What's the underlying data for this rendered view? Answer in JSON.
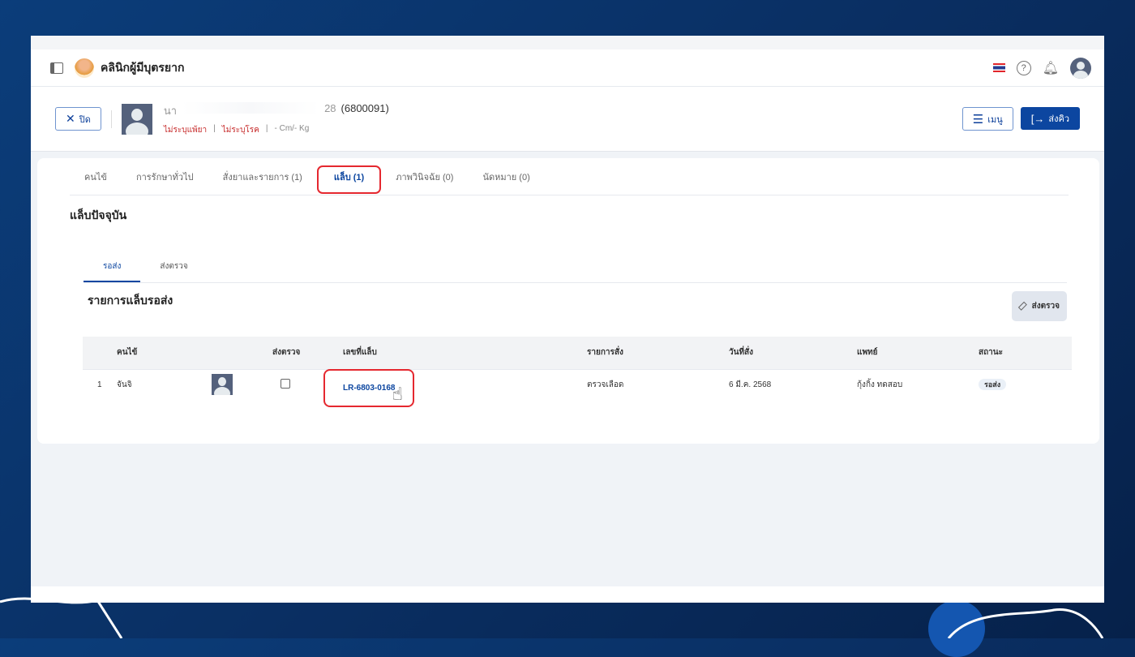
{
  "app": {
    "title": "คลินิกผู้มีบุตรยาก"
  },
  "patient": {
    "close_label": "ปิด",
    "name_prefix": "นา",
    "name_suffix": "28",
    "hn": "(6800091)",
    "allergy": "ไม่ระบุแพ้ยา",
    "disease": "ไม่ระบุโรค",
    "body": "- Cm/- Kg",
    "menu_label": "เมนู",
    "queue_label": "ส่งคิว"
  },
  "tabs": [
    {
      "label": "คนไข้"
    },
    {
      "label": "การรักษาทั่วไป"
    },
    {
      "label": "สั่งยาและรายการ (1)"
    },
    {
      "label": "แล็บ (1)"
    },
    {
      "label": "ภาพวินิจฉัย (0)"
    },
    {
      "label": "นัดหมาย (0)"
    }
  ],
  "section_title": "แล็บปัจจุบัน",
  "subtabs": [
    {
      "label": "รอส่ง"
    },
    {
      "label": "ส่งตรวจ"
    }
  ],
  "list_title": "รายการแล็บรอส่ง",
  "send_button": "ส่งตรวจ",
  "table": {
    "headers": [
      "คนไข้",
      "ส่งตรวจ",
      "เลขที่แล็บ",
      "รายการสั่ง",
      "วันที่สั่ง",
      "แพทย์",
      "สถานะ"
    ],
    "rows": [
      {
        "no": "1",
        "patient": "จันจิ",
        "lab_no": "LR-6803-0168",
        "order": "ตรวจเลือด",
        "date": "6 มี.ค. 2568",
        "doctor": "กุ้งกิ้ง ทดสอบ",
        "status": "รอส่ง"
      }
    ]
  },
  "colors": {
    "primary": "#0c46a0",
    "highlight": "#e5282f",
    "background": "#0b3d7a"
  }
}
